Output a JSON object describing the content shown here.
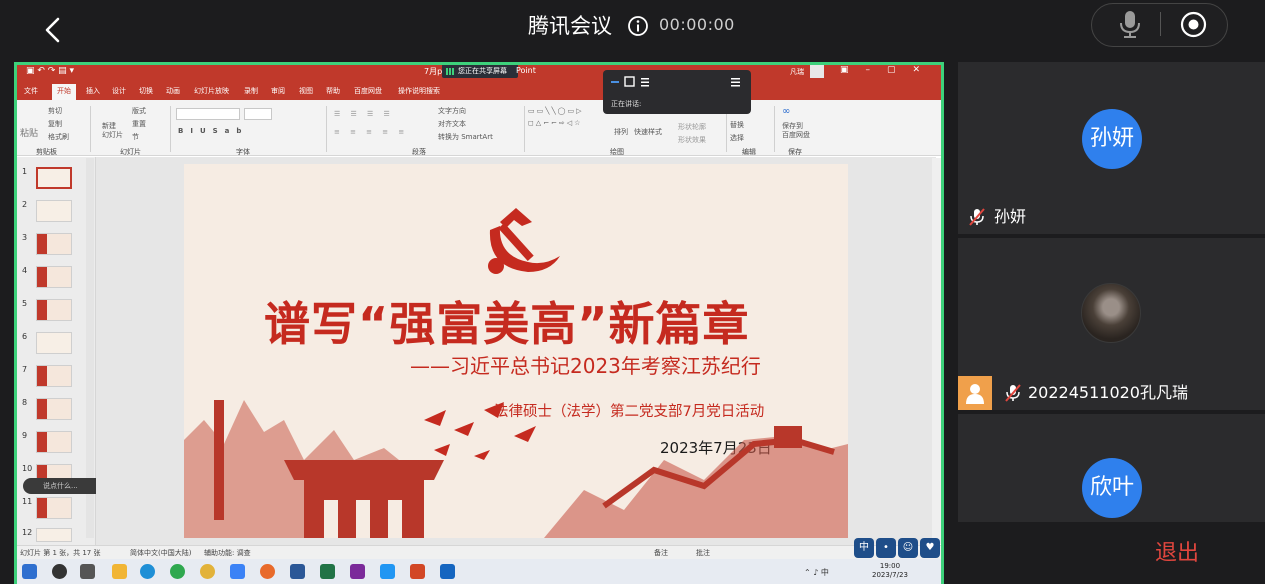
{
  "meeting": {
    "app_title": "腾讯会议",
    "timer": "00:00:00",
    "leave_label": "退出"
  },
  "colors": {
    "accent_share_border": "#3dd17b",
    "participant_avatar": "#2f80ed",
    "leave": "#e0463e",
    "ppt_red": "#c0392b"
  },
  "icons": {
    "back": "chevron-left-icon",
    "info": "info-icon",
    "mic": "microphone-icon",
    "record": "record-icon",
    "mic_off": "mic-off-icon"
  },
  "participants": [
    {
      "avatar_text": "孙妍",
      "name": "孙妍",
      "muted": true
    },
    {
      "avatar_text": "",
      "name": "20224511020孔凡瑞",
      "muted": true,
      "host": true
    },
    {
      "avatar_text": "欣叶",
      "name": "",
      "muted": false
    }
  ],
  "shared_screen": {
    "ppt": {
      "doc_title_fragment_left": "7月p",
      "doc_title_fragment_right": "Point",
      "sharing_badge": "您正在共享屏幕",
      "user": "凡瑞",
      "tabs": [
        "文件",
        "开始",
        "插入",
        "设计",
        "切换",
        "动画",
        "幻灯片放映",
        "录制",
        "审阅",
        "视图",
        "帮助",
        "百度网盘",
        "操作说明搜索"
      ],
      "ribbon_groups": [
        "剪贴板",
        "幻灯片",
        "字体",
        "段落",
        "绘图",
        "编辑",
        "保存"
      ],
      "ribbon_items": {
        "cut": "剪切",
        "copy": "复制",
        "format_painter": "格式刷",
        "paste": "粘贴",
        "new_slide": "新建\n幻灯片",
        "layout": "版式",
        "reset": "重置",
        "section": "节",
        "text_direction": "文字方向",
        "align_text": "对齐文本",
        "smartart": "转换为 SmartArt",
        "arrange": "排列",
        "quick_styles": "快速样式",
        "shape_fill": "形状填充",
        "shape_outline": "形状轮廓",
        "shape_effects": "形状效果",
        "find": "查找",
        "replace": "替换",
        "select": "选择",
        "save_baidu": "保存到\n百度网盘"
      },
      "speaking_label": "正在讲话:",
      "thumb_numbers": [
        "1",
        "2",
        "3",
        "4",
        "5",
        "6",
        "7",
        "8",
        "9",
        "10",
        "11",
        "12"
      ],
      "comment_bubble": "说点什么...",
      "status": {
        "slide_info": "幻灯片 第 1 张，共 17 张",
        "language": "简体中文(中国大陆)",
        "accessibility": "辅助功能: 调查",
        "notes": "备注",
        "comments": "批注"
      },
      "taskbar": {
        "time": "19:00",
        "date": "2023/7/23",
        "ime": "中"
      },
      "mini_icons": [
        "中",
        "",
        "",
        ""
      ]
    },
    "slide": {
      "title": "谱写“强富美高”新篇章",
      "subtitle": "——习近平总书记2023年考察江苏纪行",
      "branch": "法律硕士（法学）第二党支部7月党日活动",
      "date": "2023年7月23日"
    }
  }
}
